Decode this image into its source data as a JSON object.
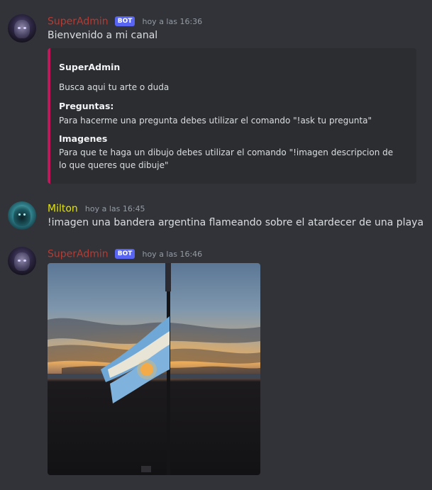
{
  "messages": [
    {
      "author": "SuperAdmin",
      "bot_tag": "BOT",
      "timestamp": "hoy a las 16:36",
      "content": "Bienvenido a mi canal",
      "embed": {
        "author": "SuperAdmin",
        "description": "Busca aqui tu arte o duda",
        "fields": [
          {
            "name": "Preguntas:",
            "value": "Para hacerme una pregunta debes utilizar el comando \"!ask tu pregunta\""
          },
          {
            "name": "Imagenes",
            "value": "Para que te haga un dibujo debes utilizar el comando \"!imagen descripcion de lo que queres que dibuje\""
          }
        ],
        "accent_color": "#c2185b"
      }
    },
    {
      "author": "Milton",
      "timestamp": "hoy a las 16:45",
      "content": "!imagen una bandera argentina flameando sobre el atardecer de una playa"
    },
    {
      "author": "SuperAdmin",
      "bot_tag": "BOT",
      "timestamp": "hoy a las 16:46",
      "attachment": "generated-image-argentine-flag-sunset-beach"
    }
  ],
  "colors": {
    "background": "#313338",
    "bot_name": "#b83a32",
    "milton_name": "#e5e500",
    "bot_tag": "#5865f2",
    "timestamp": "#949ba4"
  }
}
